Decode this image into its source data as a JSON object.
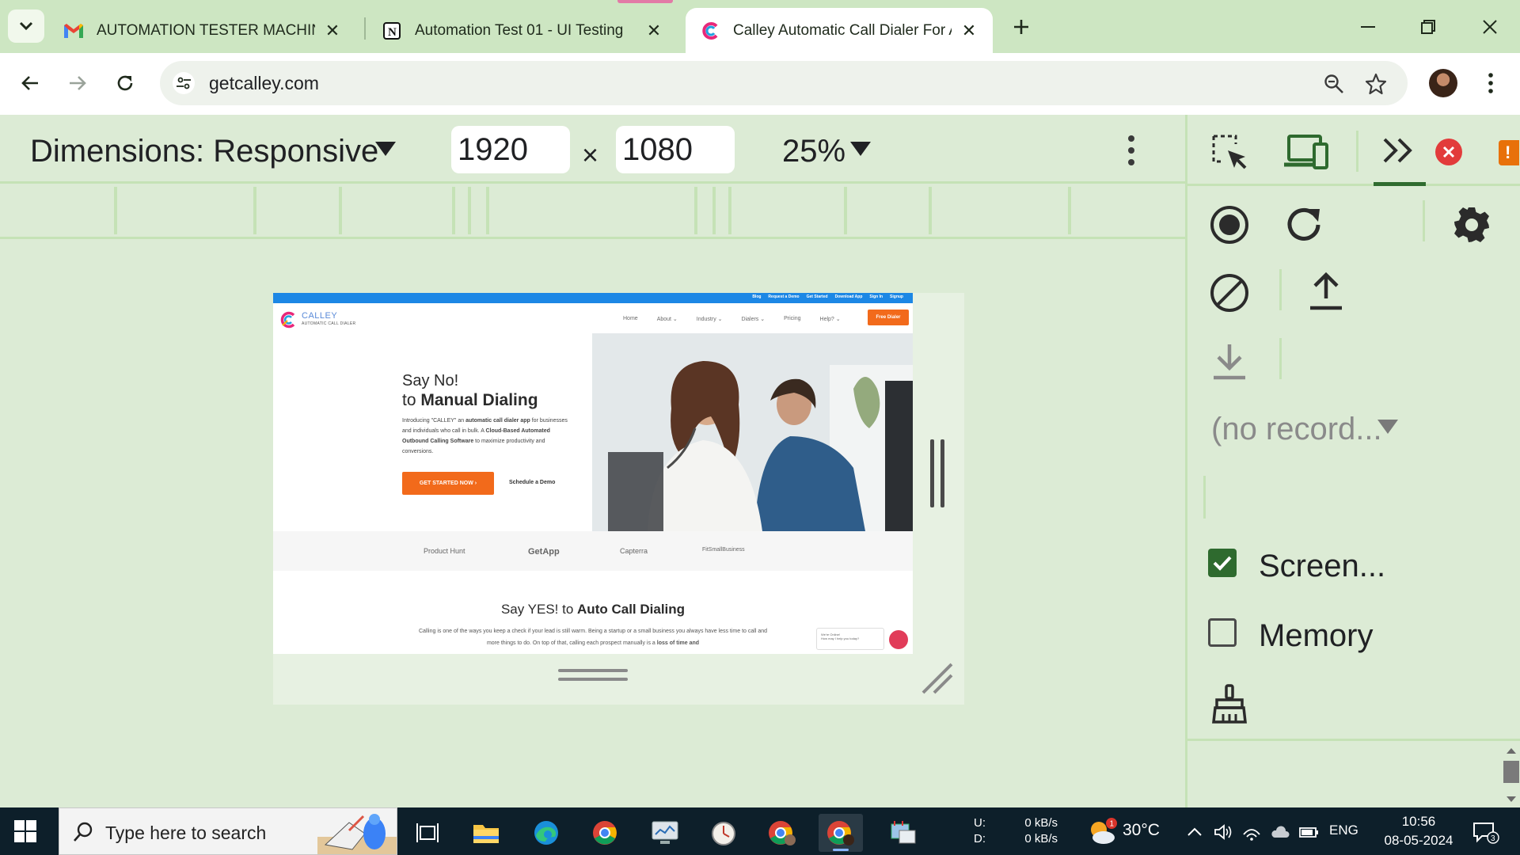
{
  "browser": {
    "tabs": [
      {
        "title": "AUTOMATION TESTER MACHINE T",
        "icon": "gmail-icon"
      },
      {
        "title": "Automation Test 01 - UI Testing",
        "icon": "notion-icon"
      },
      {
        "title": "Calley Automatic Call Dialer For Ar",
        "icon": "calley-icon",
        "active": true
      }
    ],
    "url": "getcalley.com"
  },
  "device_toolbar": {
    "dimensions_label": "Dimensions: Responsive",
    "width_value": "1920",
    "height_value": "1080",
    "times": "×",
    "zoom": "25%"
  },
  "calley_page": {
    "top_links": [
      "Blog",
      "Request a Demo",
      "Get Started",
      "Download App",
      "Sign In",
      "Signup"
    ],
    "logo_text": "CALLEY",
    "logo_sub": "AUTOMATIC CALL DIALER",
    "menu": [
      "Home",
      "About ⌄",
      "Industry ⌄",
      "Dialers ⌄",
      "Pricing",
      "Help? ⌄"
    ],
    "free_dialer": "Free Dialer",
    "hero_line1": "Say No!",
    "hero_line2_prefix": "to ",
    "hero_line2_bold": "Manual Dialing",
    "hero_para_1": "Introducing \"CALLEY\" an ",
    "hero_para_bold1": "automatic call dialer app",
    "hero_para_2": " for businesses and individuals who call in bulk. A ",
    "hero_para_bold2": "Cloud-Based Automated Outbound Calling Software",
    "hero_para_3": " to maximize productivity and conversions.",
    "cta": "GET STARTED NOW ›",
    "demo": "Schedule a Demo",
    "review_logos": [
      "Product Hunt",
      "GetApp",
      "Capterra",
      "FitSmallBusiness"
    ],
    "section_prefix": "Say YES! to ",
    "section_bold": "Auto Call Dialing",
    "section_para": "Calling is one of the ways you keep a check if your lead is still warm. Being a startup or a small business you always have less time to call and more things to do. On top of that, calling each prospect manually is a ",
    "section_para_bold": "loss of time and",
    "chat_line1": "We're Online!",
    "chat_line2": "How may I help you today?"
  },
  "devtools": {
    "recording_select": "(no record...",
    "screenshots_label": "Screen...",
    "screenshots_checked": true,
    "memory_label": "Memory",
    "memory_checked": false,
    "warning_badge": "!"
  },
  "taskbar": {
    "search_placeholder": "Type here to search",
    "net_up_label": "U:",
    "net_down_label": "D:",
    "net_up_value": "0 kB/s",
    "net_down_value": "0 kB/s",
    "temperature": "30°C",
    "weather_badge": "1",
    "language": "ENG",
    "time": "10:56",
    "date": "08-05-2024",
    "notification_count": "3"
  },
  "colors": {
    "chrome_frame": "#cde6c2",
    "devtools_bg": "#dcebd5",
    "calley_orange": "#f26a1b",
    "calley_blue": "#1c87e5",
    "taskbar": "#0d1f2a"
  }
}
